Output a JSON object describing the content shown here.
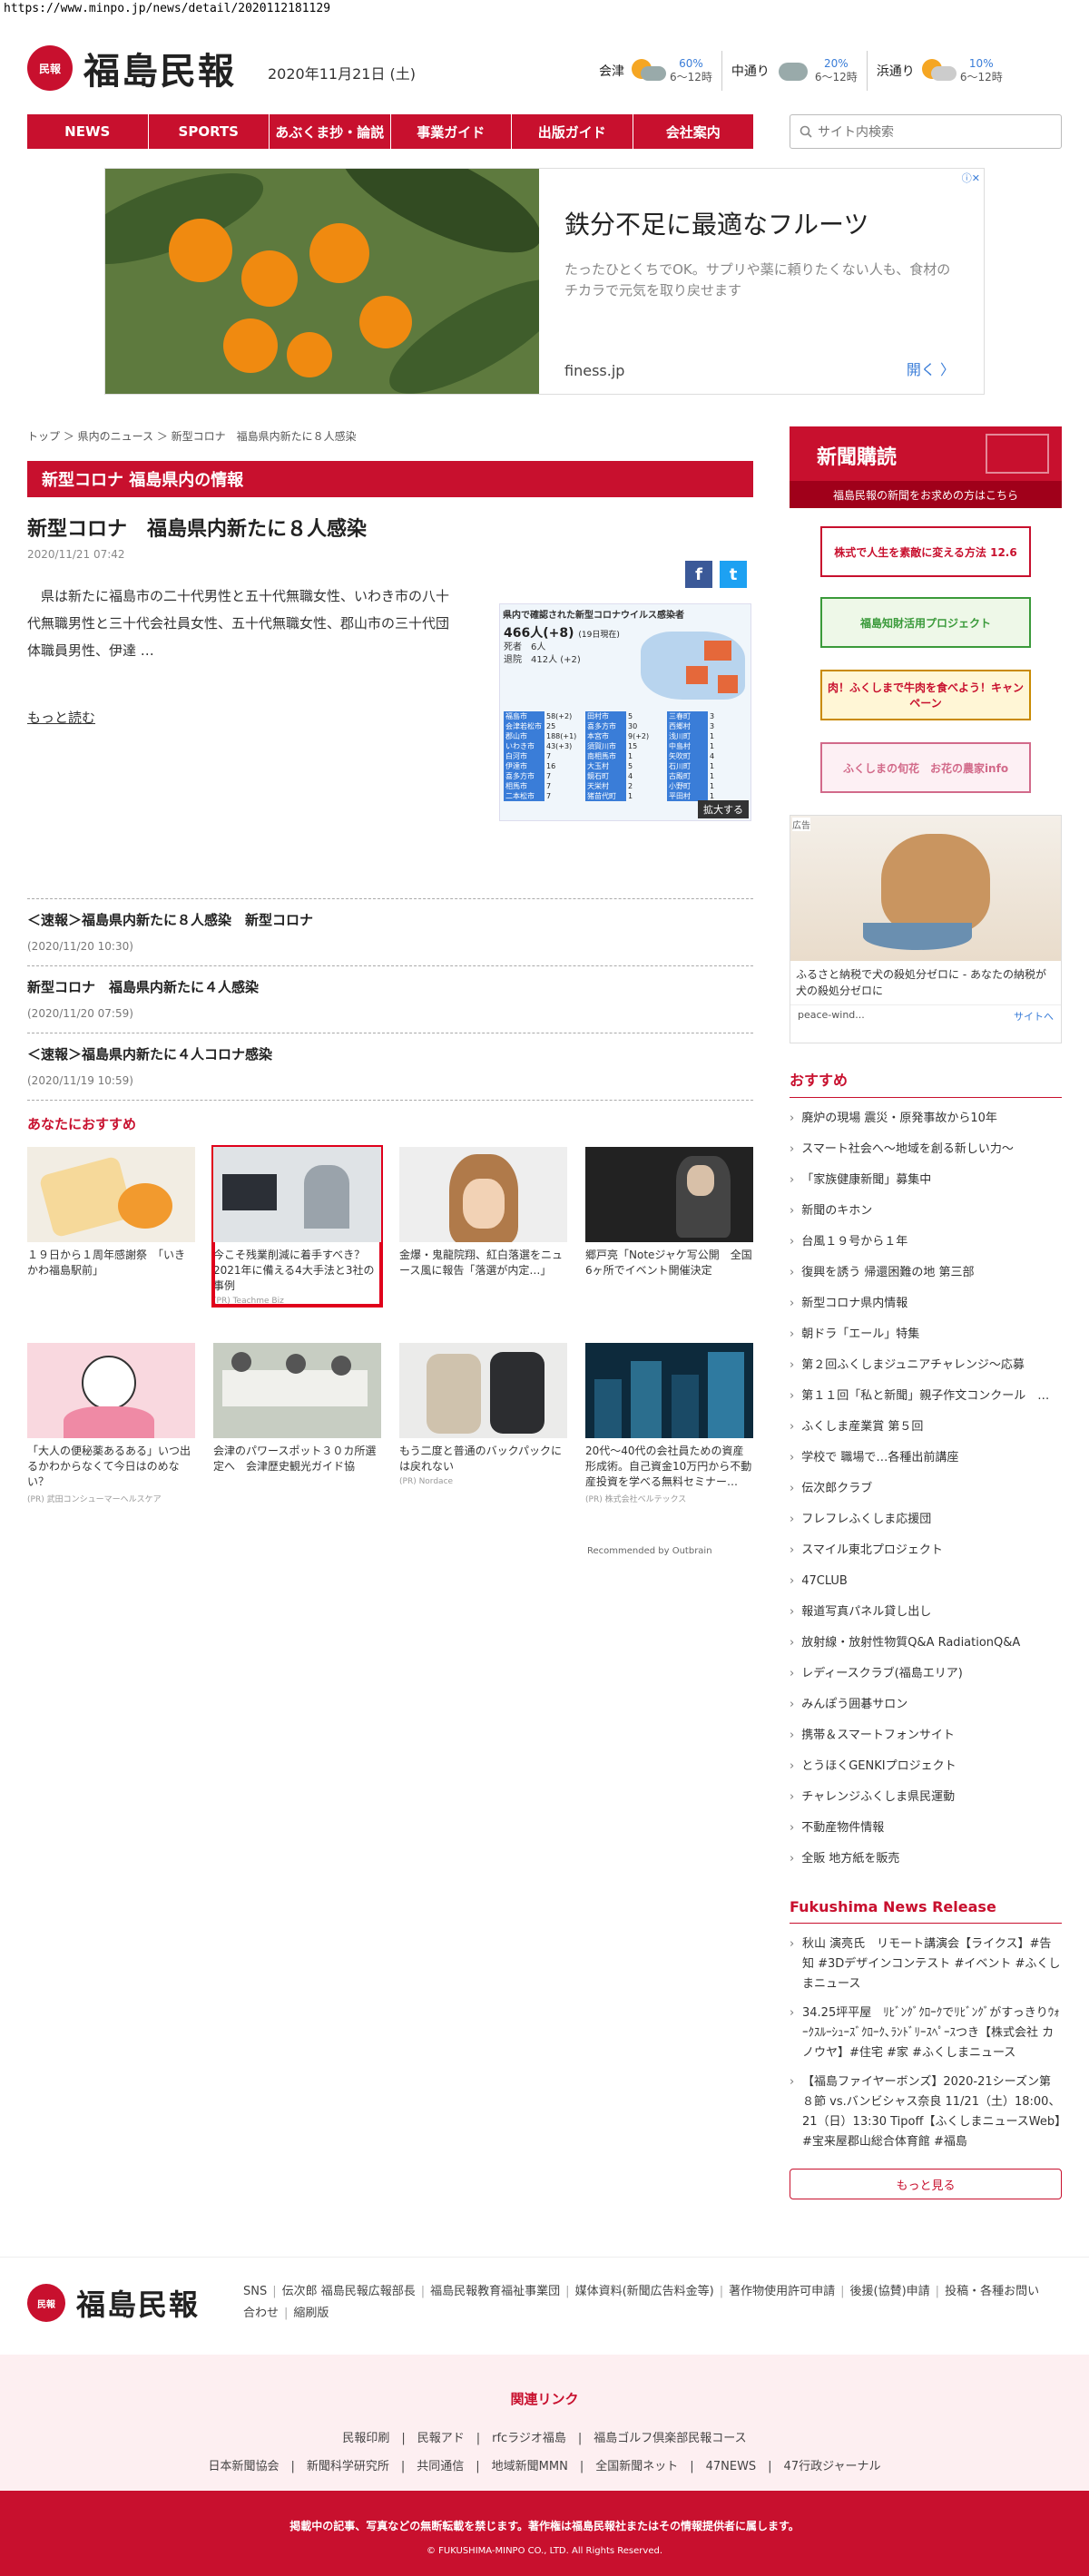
{
  "url": "https://www.minpo.jp/news/detail/2020112181129",
  "header": {
    "logo_mark": "民報",
    "logo_text": "福島民報",
    "date": "2020年11月21日 (土)"
  },
  "weather": [
    {
      "city": "会津",
      "pct": "60%",
      "time": "6〜12時",
      "icon": "sun-cloud-icon"
    },
    {
      "city": "中通り",
      "pct": "20%",
      "time": "6〜12時",
      "icon": "cloud-icon"
    },
    {
      "city": "浜通り",
      "pct": "10%",
      "time": "6〜12時",
      "icon": "sun-cloud-icon"
    }
  ],
  "nav": [
    "NEWS",
    "SPORTS",
    "あぶくま抄・論説",
    "事業ガイド",
    "出版ガイド",
    "会社案内"
  ],
  "search": {
    "placeholder": "サイト内検索"
  },
  "ad_top": {
    "title": "鉄分不足に最適なフルーツ",
    "desc": "たったひとくちでOK。サプリや薬に頼りたくない人も、食材のチカラで元気を取り戻せます",
    "domain": "finess.jp",
    "open": "開く 〉"
  },
  "breadcrumb": "トップ ＞ 県内のニュース ＞ 新型コロナ　福島県内新たに８人感染",
  "section": "新型コロナ 福島県内の情報",
  "article": {
    "title": "新型コロナ　福島県内新たに８人感染",
    "date": "2020/11/21 07:42",
    "body": "県は新たに福島市の二十代男性と五十代無職女性、いわき市の八十代無職男性と三十代会社員女性、五十代無職女性、郡山市の三十代団体職員男性、伊達 …",
    "more": "もっと読む"
  },
  "infographic": {
    "title": "県内で確認された新型コロナウイルス感染者",
    "total": "466人(+8)",
    "total_note": "(19日現在)",
    "deaths": "死者　6人",
    "recovered": "退院　412人 (+2)",
    "zoom": "拡大する",
    "rows": [
      [
        "福島市",
        "58(+2)",
        "田村市",
        "5",
        "三春町",
        "3"
      ],
      [
        "会津若松市",
        "25",
        "喜多方市",
        "30",
        "西郷村",
        "3"
      ],
      [
        "郡山市",
        "188(+1)",
        "本宮市",
        "9(+2)",
        "浅川町",
        "1"
      ],
      [
        "いわき市",
        "43(+3)",
        "須賀川市",
        "15",
        "中島村",
        "1"
      ],
      [
        "白河市",
        "7",
        "南相馬市",
        "1",
        "矢吹町",
        "4"
      ],
      [
        "伊達市",
        "16",
        "大玉村",
        "5",
        "石川町",
        "1"
      ],
      [
        "喜多方市",
        "7",
        "鏡石町",
        "4",
        "古殿町",
        "1"
      ],
      [
        "相馬市",
        "7",
        "天栄村",
        "2",
        "小野町",
        "1"
      ],
      [
        "二本松市",
        "7",
        "猪苗代町",
        "1",
        "平田村",
        "1"
      ]
    ]
  },
  "news": [
    {
      "title": "＜速報＞福島県内新たに８人感染　新型コロナ",
      "date": "(2020/11/20 10:30)"
    },
    {
      "title": "新型コロナ　福島県内新たに４人感染",
      "date": "(2020/11/20 07:59)"
    },
    {
      "title": "＜速報＞福島県内新たに４人コロナ感染",
      "date": "(2020/11/19 10:59)"
    }
  ],
  "recommend": {
    "heading": "あなたにおすすめ",
    "row1": [
      {
        "title": "１９日から１周年感謝祭　「いきかわ福島駅前」",
        "source": ""
      },
      {
        "title": "今こそ残業削減に着手すべき？2021年に備える4大手法と3社の事例",
        "source": "(PR) Teachme Biz"
      },
      {
        "title": "金爆・鬼龍院翔、紅白落選をニュース風に報告「落選が内定…」",
        "source": ""
      },
      {
        "title": "郷戸亮「Noteジャケ写公開　全国6ヶ所でイベント開催決定",
        "source": ""
      }
    ],
    "row2": [
      {
        "title": "「大人の便秘薬あるある」いつ出るかわからなくて今日はのめない？",
        "source": "(PR) 武田コンシューマーヘルスケア"
      },
      {
        "title": "会津のパワースポット３０カ所選定へ　会津歴史観光ガイド協",
        "source": ""
      },
      {
        "title": "もう二度と普通のバックパックには戻れない",
        "source": "(PR) Nordace"
      },
      {
        "title": "20代〜40代の会社員ための資産形成術。自己資金10万円から不動産投資を学べる無料セミナー…",
        "source": "(PR) 株式会社ベルテックス"
      }
    ],
    "outbrain": "Recommended by Outbrain"
  },
  "sidebar": {
    "subscribe": {
      "title": "新聞購読",
      "desc": "福島民報の新聞をお求めの方はこちら"
    },
    "banners": [
      {
        "text": "株式で人生を素敵に変える方法 12.6",
        "color": "#c8102e"
      },
      {
        "text": "福島知財活用プロジェクト",
        "color": "#3a9a3a"
      },
      {
        "text": "肉！ふくしまで牛肉を食べよう！キャンペーン",
        "color": "#c98a00"
      },
      {
        "text": "ふくしまの旬花　お花の農家info",
        "color": "#d26a8a"
      }
    ],
    "ad": {
      "label": "広告",
      "text": "ふるさと納税で犬の殺処分ゼロに - あなたの納税が犬の殺処分ゼロに",
      "brand": "peace-wind...",
      "site": "サイトへ"
    },
    "osusume_heading": "おすすめ",
    "osusume": [
      "廃炉の現場 震災・原発事故から10年",
      "スマート社会へ〜地域を創る新しい力〜",
      "「家族健康新聞」募集中",
      "新聞のキホン",
      "台風１９号から１年",
      "復興を誘う 帰還困難の地 第三部",
      "新型コロナ県内情報",
      "朝ドラ「エール」特集",
      "第２回ふくしまジュニアチャレンジ〜応募",
      "第１１回「私と新聞」親子作文コンクール　…",
      "ふくしま産業賞 第５回",
      "学校で 職場で…各種出前講座",
      "伝次郎クラブ",
      "フレフレふくしま応援団",
      "スマイル東北プロジェクト",
      "47CLUB",
      "報道写真パネル貸し出し",
      "放射線・放射性物質Q&A RadiationQ&A",
      "レディースクラブ(福島エリア)",
      "みんぽう囲碁サロン",
      "携帯＆スマートフォンサイト",
      "とうほくGENKIプロジェクト",
      "チャレンジふくしま県民運動",
      "不動産物件情報",
      "全販 地方紙を販売"
    ],
    "release_heading": "Fukushima News Release",
    "releases": [
      "秋山 演亮氏　リモート講演会【ライクス】#告知 #3Dデザインコンテスト #イベント #ふくしまニュース",
      "34.25坪平屋　ﾘﾋﾞﾝｸﾞｸﾛｰｸでﾘﾋﾞﾝｸﾞがすっきりｳｫｰｸｽﾙｰｼｭｰｽﾞｸﾛｰｸ､ﾗﾝﾄﾞﾘｰｽﾍﾟｰｽつき【株式会社 カノウヤ】#住宅 #家 #ふくしまニュース",
      "【福島ファイヤーボンズ】2020-21シーズン第８節 vs.バンビシャス奈良 11/21（土）18:00、21（日）13:30 Tipoff【ふくしまニュースWeb】#宝来屋郡山総合体育館 #福島"
    ],
    "more": "もっと見る"
  },
  "footer": {
    "links": [
      "SNS",
      "伝次郎 福島民報広報部長",
      "福島民報教育福祉事業団",
      "媒体資料(新聞広告料金等)",
      "著作物使用許可申請",
      "後援(協賛)申請",
      "投稿・各種お問い合わせ",
      "縮刷版"
    ],
    "related_title": "関連リンク",
    "related_row1": "民報印刷　|　民報アド　|　rfcラジオ福島　|　福島ゴルフ倶楽部民報コース",
    "related_row2": "日本新聞協会　|　新聞科学研究所　|　共同通信　|　地域新聞MMN　|　全国新聞ネット　|　47NEWS　|　47行政ジャーナル",
    "notice": "掲載中の記事、写真などの無断転載を禁じます。著作権は福島民報社またはその情報提供者に属します。",
    "copyright": "© FUKUSHIMA-MINPO CO., LTD. All Rights Reserved."
  }
}
